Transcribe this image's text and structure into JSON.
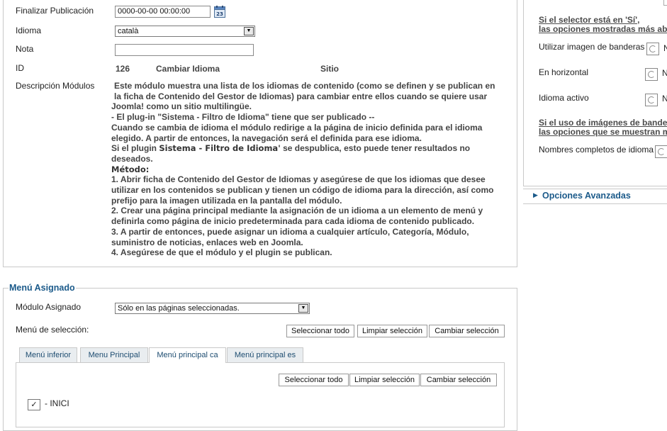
{
  "form": {
    "finalizar_label": "Finalizar Publicación",
    "finalizar_value": "0000-00-00 00:00:00",
    "idioma_label": "Idioma",
    "idioma_value": "català",
    "nota_label": "Nota",
    "nota_value": "",
    "id_label": "ID",
    "id_number": "126",
    "id_name": "Cambiar Idioma",
    "id_site": "Sitio",
    "desc_label": "Descripción Módulos",
    "desc_lines": [
      "Este módulo muestra una lista de los idiomas de contenido (como se definen y se publican en",
      "la ficha de Contenido del Gestor de Idiomas) para cambiar entre ellos cuando se quiere usar",
      "Joomla! como un sitio multilingüe.",
      "- El plug-in \"Sistema - Filtro de Idioma\" tiene que ser publicado --",
      "Cuando se cambia de idioma el módulo redirige a la página de inicio definida para el idioma",
      "elegido. A partir de entonces, la navegación será el definida para ese idioma.",
      "Si el plugin",
      "Sistema - Filtro de Idioma'",
      "se despublica, esto puede tener resultados no",
      "deseados.",
      "Método:",
      "1. Abrir ficha de Contenido del Gestor de Idiomas y asegúrese de que los idiomas que desee",
      "utilizar en los contenidos se publican y tienen un código de idioma para la dirección, así como",
      "prefijo para la imagen utilizada en la pantalla del módulo.",
      "2. Crear una página principal mediante la asignación de un idioma a un elemento de menú y",
      "definirla como página de inicio predeterminada para cada idioma de contenido publicado.",
      "3. A partir de entonces, puede asignar un idioma a cualquier artículo, Categoría, Módulo,",
      "suministro de noticias, enlaces web en Joomla.",
      "4. Asegúrese de que el módulo y el plugin se publican."
    ]
  },
  "menu_assign": {
    "legend": "Menú Asignado",
    "modulo_label": "Módulo Asignado",
    "modulo_value": "Sólo en las páginas seleccionadas.",
    "seleccion_label": "Menú de selección:",
    "btn_select_all": "Seleccionar todo",
    "btn_clear": "Limpiar selección",
    "btn_toggle": "Cambiar selección",
    "tabs": [
      "Menú inferior",
      "Menu Principal",
      "Menú principal ca",
      "Menú principal es"
    ],
    "tab_btn_select_all": "Seleccionar todo",
    "tab_btn_clear": "Limpiar selección",
    "tab_btn_toggle": "Cambiar selección",
    "item_label": "- INICI",
    "item_checked": "✓"
  },
  "right": {
    "note1_line1": "Si el selector está en 'Sí',",
    "note1_line2": "las opciones mostradas más aba",
    "opt_flags": "Utilizar imagen de banderas",
    "opt_horizontal": "En horizontal",
    "opt_active": "Idioma activo",
    "radio_letter": "N",
    "note2_line1": "Si el uso de imágenes de bander",
    "note2_line2": "las opciones que se muestran m",
    "opt_fullnames": "Nombres completos de idioma",
    "advanced": "Opciones Avanzadas"
  },
  "icons": {
    "calendar": "calendar-icon",
    "expand": "triangle-right-icon"
  },
  "colors": {
    "accent": "#1b5a8a",
    "border": "#c9c9c9",
    "tab_bg": "#e9edf0"
  }
}
